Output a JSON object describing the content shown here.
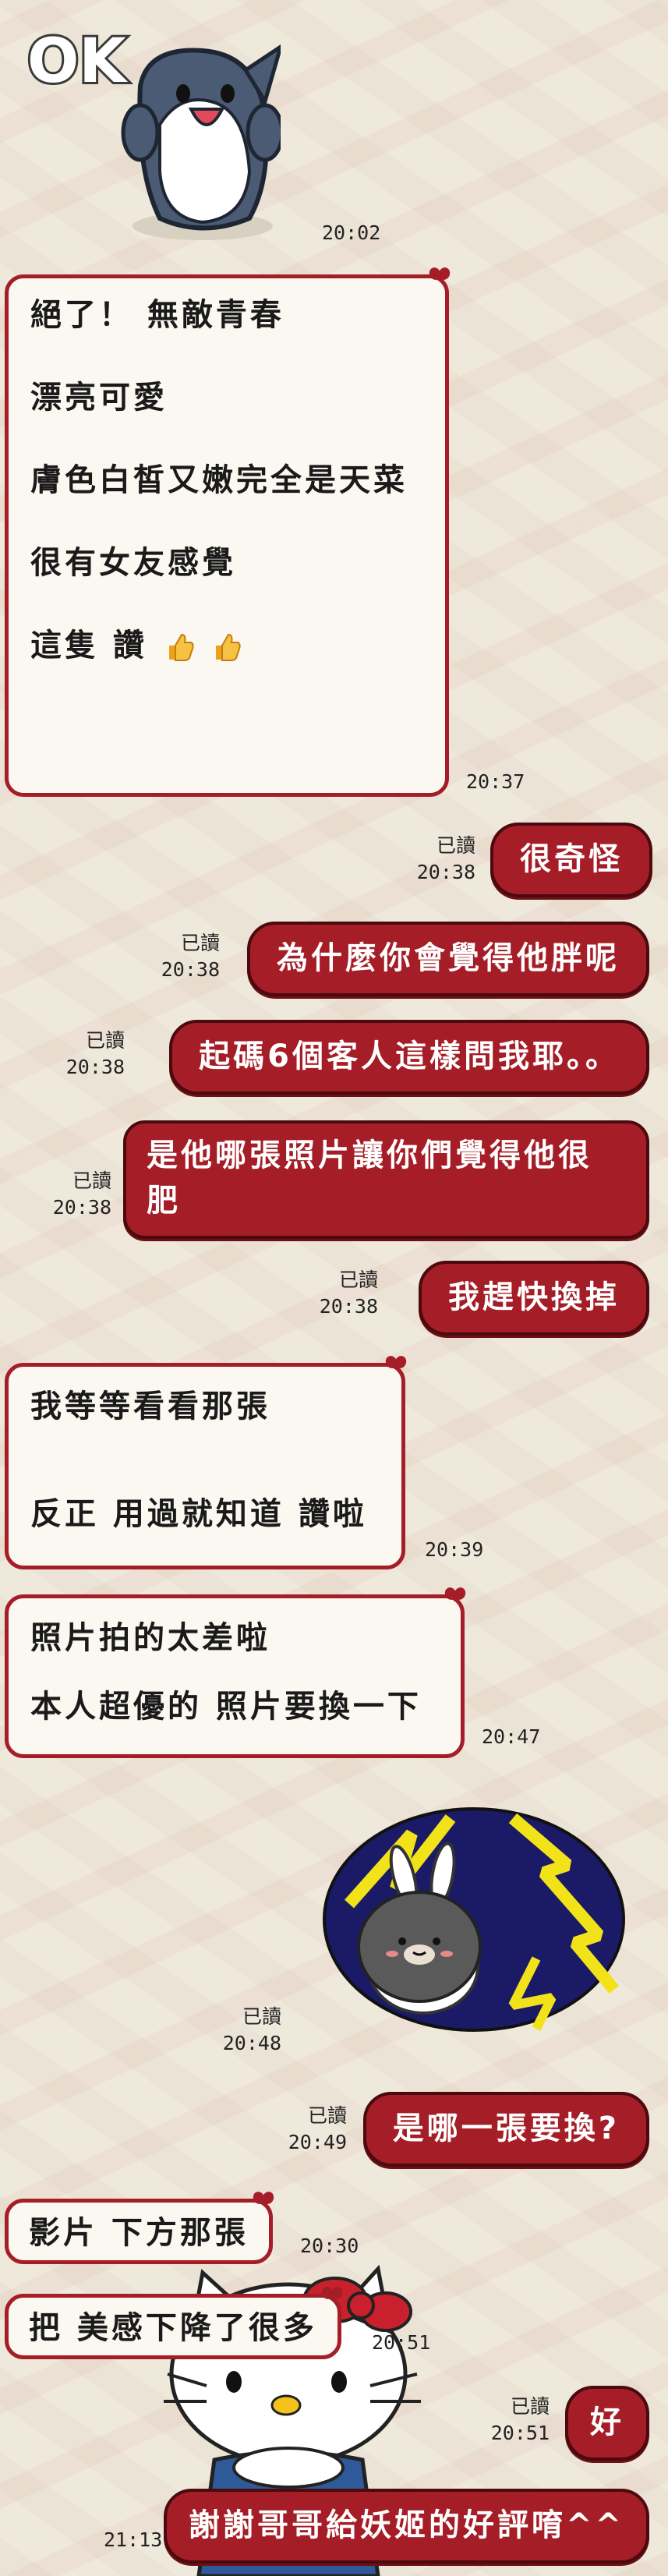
{
  "colors": {
    "bubble_out": "#a51d26",
    "bubble_in_bg": "#fbf8f1",
    "bubble_in_border": "#a51d26",
    "background": "#efe9dc"
  },
  "sticker_ok": {
    "text": "OK",
    "time": "20:02"
  },
  "msg1": {
    "lines": [
      "絕了！  無敵青春",
      "漂亮可愛",
      "膚色白皙又嫩完全是天菜",
      " 很有女友感覺",
      " 這隻 讚"
    ],
    "icon": "thumbs-up-icon",
    "time": "20:37"
  },
  "msg2": {
    "text": "很奇怪",
    "read": "已讀",
    "time": "20:38"
  },
  "msg3": {
    "text": "為什麼你會覺得他胖呢",
    "read": "已讀",
    "time": "20:38"
  },
  "msg4": {
    "text": "起碼6個客人這樣問我耶。。",
    "read": "已讀",
    "time": "20:38"
  },
  "msg5": {
    "lines": [
      "是他哪張照片讓你們覺得他很",
      "肥"
    ],
    "read": "已讀",
    "time": "20:38"
  },
  "msg6": {
    "text": "我趕快換掉",
    "read": "已讀",
    "time": "20:38"
  },
  "msg7": {
    "lines": [
      "我等等看看那張",
      "反正 用過就知道 讚啦"
    ],
    "time": "20:39"
  },
  "msg8": {
    "lines": [
      "照片拍的太差啦",
      "本人超優的 照片要換一下"
    ],
    "time": "20:47"
  },
  "sticker_brown": {
    "icon": "brown-bear-lightning-sticker",
    "read": "已讀",
    "time": "20:48"
  },
  "msg9": {
    "text": "是哪一張要換?",
    "read": "已讀",
    "time": "20:49"
  },
  "msg10": {
    "text": "影片 下方那張",
    "time": "20:30"
  },
  "msg11": {
    "text": "把 美感下降了很多",
    "time": "20:51"
  },
  "msg12": {
    "text": "好",
    "read": "已讀",
    "time": "20:51"
  },
  "msg13": {
    "text": "謝謝哥哥給妖姬的好評唷^^",
    "time": "21:13"
  }
}
